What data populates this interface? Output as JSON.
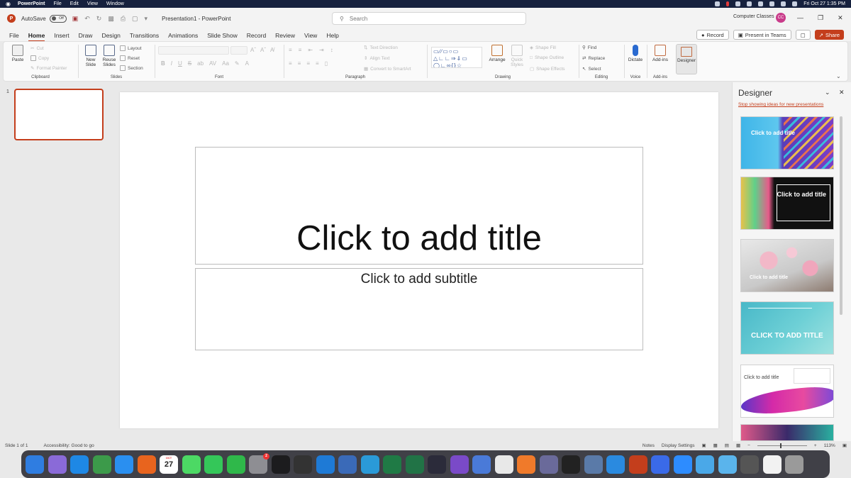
{
  "menubar": {
    "app": "PowerPoint",
    "items": [
      "File",
      "Edit",
      "View",
      "Window"
    ],
    "datetime": "Fri Oct 27  1:35 PM"
  },
  "titlebar": {
    "autosave_label": "AutoSave",
    "autosave_state": "Off",
    "doc_title": "Presentation1  -  PowerPoint",
    "search_placeholder": "Search",
    "account": "Computer Classes",
    "avatar_initials": "CC"
  },
  "tabs": [
    "File",
    "Home",
    "Insert",
    "Draw",
    "Design",
    "Transitions",
    "Animations",
    "Slide Show",
    "Record",
    "Review",
    "View",
    "Help"
  ],
  "tab_actions": {
    "record": "Record",
    "present": "Present in Teams",
    "share": "Share"
  },
  "ribbon": {
    "clipboard": {
      "label": "Clipboard",
      "paste": "Paste",
      "cut": "Cut",
      "copy": "Copy",
      "format_painter": "Format Painter"
    },
    "slides": {
      "label": "Slides",
      "new_slide": "New Slide",
      "reuse_slides": "Reuse Slides",
      "layout": "Layout",
      "reset": "Reset",
      "section": "Section"
    },
    "font": {
      "label": "Font"
    },
    "paragraph": {
      "label": "Paragraph",
      "text_direction": "Text Direction",
      "align_text": "Align Text",
      "convert_smartart": "Convert to SmartArt"
    },
    "drawing": {
      "label": "Drawing",
      "arrange": "Arrange",
      "quick_styles": "Quick Styles",
      "shape_fill": "Shape Fill",
      "shape_outline": "Shape Outline",
      "shape_effects": "Shape Effects"
    },
    "editing": {
      "label": "Editing",
      "find": "Find",
      "replace": "Replace",
      "select": "Select"
    },
    "voice": {
      "label": "Voice",
      "dictate": "Dictate"
    },
    "addins": {
      "label": "Add-ins",
      "addins": "Add-ins",
      "designer": "Designer"
    }
  },
  "thumbnail": {
    "number": "1"
  },
  "slide": {
    "title_placeholder": "Click to add title",
    "subtitle_placeholder": "Click to add subtitle"
  },
  "designer": {
    "title": "Designer",
    "stop_link": "Stop showing ideas for new presentations",
    "cards": [
      {
        "text": "Click to add title"
      },
      {
        "text": "Click to add title"
      },
      {
        "text": "Click to add title"
      },
      {
        "text": "CLICK TO ADD TITLE"
      },
      {
        "text": "Click to add title"
      }
    ]
  },
  "status": {
    "slide_count": "Slide 1 of 1",
    "accessibility": "Accessibility: Good to go",
    "notes": "Notes",
    "display_settings": "Display Settings",
    "zoom": "113%"
  },
  "dock": {
    "calendar_day": "27",
    "badge": "2",
    "apps": [
      {
        "name": "finder-icon",
        "color": "#2f7de1"
      },
      {
        "name": "launchpad-icon",
        "color": "#8a6ad8"
      },
      {
        "name": "skype-icon",
        "color": "#1e88e5"
      },
      {
        "name": "chrome-icon",
        "color": "#3c9a4a"
      },
      {
        "name": "safari-icon",
        "color": "#2a8ff0"
      },
      {
        "name": "firefox-icon",
        "color": "#e8641e"
      },
      {
        "name": "calendar-icon",
        "color": "#ffffff"
      },
      {
        "name": "messages-icon",
        "color": "#4cd964"
      },
      {
        "name": "facetime-icon",
        "color": "#34c759"
      },
      {
        "name": "numbers-icon",
        "color": "#2fb84a"
      },
      {
        "name": "system-settings-icon",
        "color": "#8e8e93"
      },
      {
        "name": "terminal-icon",
        "color": "#1c1c1e"
      },
      {
        "name": "final-cut-icon",
        "color": "#333333"
      },
      {
        "name": "vscode-icon",
        "color": "#1e7ad6"
      },
      {
        "name": "proxyman-icon",
        "color": "#3a6ab8"
      },
      {
        "name": "affinity-icon",
        "color": "#2a9ad8"
      },
      {
        "name": "excel-icon",
        "color": "#1f7a45"
      },
      {
        "name": "excel-alt-icon",
        "color": "#217346"
      },
      {
        "name": "obs-icon",
        "color": "#2b2b3a"
      },
      {
        "name": "screen-icon",
        "color": "#7a4ac8"
      },
      {
        "name": "keynote-icon",
        "color": "#4a7ad8"
      },
      {
        "name": "textedit-icon",
        "color": "#e8e8e8"
      },
      {
        "name": "pencil-icon",
        "color": "#f07a2a"
      },
      {
        "name": "bbedit-icon",
        "color": "#6a6a9a"
      },
      {
        "name": "chatgpt-icon",
        "color": "#222222"
      },
      {
        "name": "preview-icon",
        "color": "#5a7aa8"
      },
      {
        "name": "windows-icon",
        "color": "#2a8ae0"
      },
      {
        "name": "powerpoint-icon",
        "color": "#c43e1c"
      },
      {
        "name": "firefox-dev-icon",
        "color": "#3a6ae8"
      },
      {
        "name": "zoom-icon",
        "color": "#2d8cff"
      },
      {
        "name": "folder-icon",
        "color": "#4aa8e8"
      },
      {
        "name": "folder-alt-icon",
        "color": "#5ab4ec"
      },
      {
        "name": "screenshot-icon",
        "color": "#555555"
      },
      {
        "name": "document-icon",
        "color": "#f2f2f2"
      },
      {
        "name": "trash-icon",
        "color": "#9a9a9a"
      }
    ]
  }
}
